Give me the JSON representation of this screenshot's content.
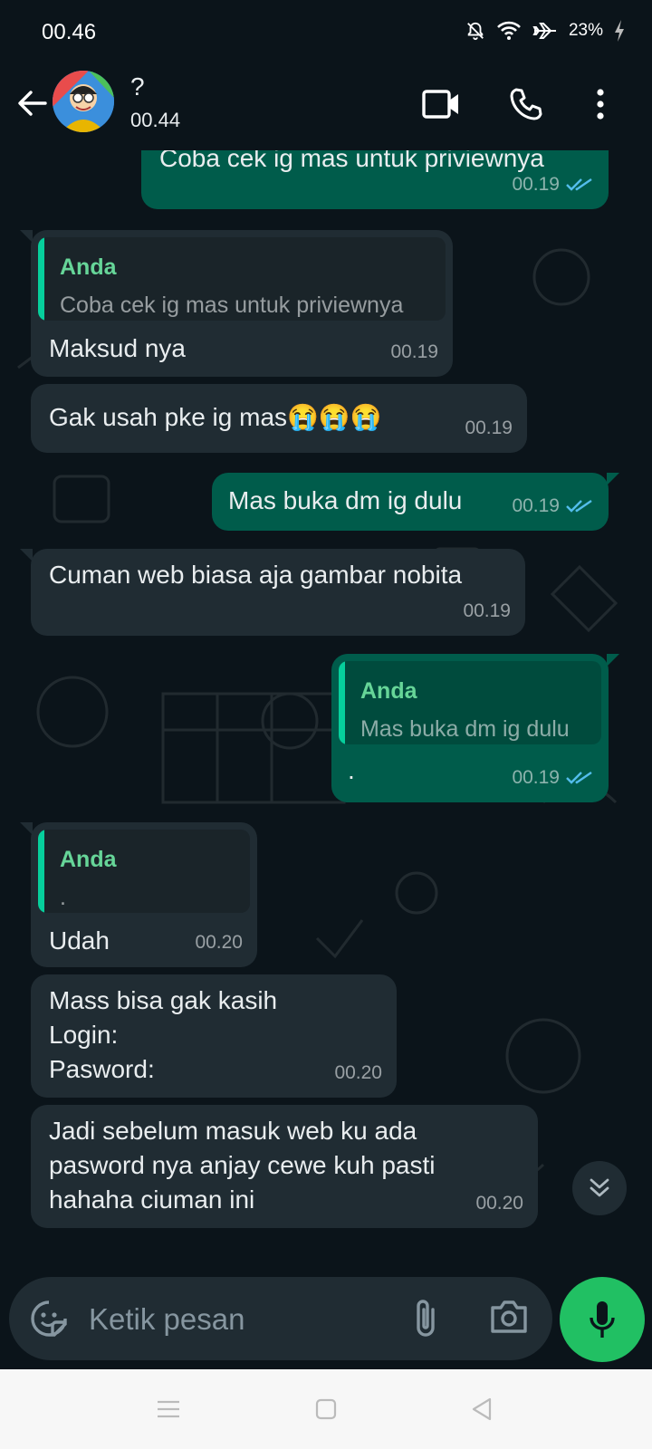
{
  "status_bar": {
    "time": "00.46",
    "battery": "23%"
  },
  "header": {
    "contact_name": "?",
    "last_seen": "00.44"
  },
  "messages": [
    {
      "direction": "out",
      "text": "Coba cek ig mas untuk priviewnya",
      "time": "00.19",
      "read": true
    },
    {
      "direction": "in",
      "quote_name": "Anda",
      "quote_text": "Coba cek ig mas untuk priviewnya",
      "text": "Maksud nya",
      "time": "00.19"
    },
    {
      "direction": "in",
      "text": "Gak usah pke ig mas😭😭😭",
      "time": "00.19"
    },
    {
      "direction": "out",
      "text": "Mas buka dm ig dulu",
      "time": "00.19",
      "read": true
    },
    {
      "direction": "in",
      "text": "Cuman web biasa aja gambar nobita",
      "time": "00.19"
    },
    {
      "direction": "out",
      "quote_name": "Anda",
      "quote_text": "Mas buka dm ig dulu",
      "text": ".",
      "time": "00.19",
      "read": true
    },
    {
      "direction": "in",
      "quote_name": "Anda",
      "quote_text": ".",
      "text": "Udah",
      "time": "00.20"
    },
    {
      "direction": "in",
      "text": "Mass bisa gak kasih\nLogin:\nPasword:",
      "time": "00.20"
    },
    {
      "direction": "in",
      "text": "Jadi sebelum masuk web ku ada\npasword nya anjay cewe kuh pasti\nhahaha ciuman ini",
      "time": "00.20"
    }
  ],
  "composer": {
    "placeholder": "Ketik pesan"
  },
  "colors": {
    "background": "#0b141a",
    "incoming_bubble": "#202c33",
    "outgoing_bubble": "#005c4b",
    "quote_name": "#66d598",
    "read_ticks": "#53bdeb",
    "mic_button": "#21c063"
  },
  "icons": {
    "status": [
      "mute-icon",
      "wifi-icon",
      "airplane-icon",
      "battery-charging-icon"
    ],
    "header": [
      "back-arrow-icon",
      "video-call-icon",
      "voice-call-icon",
      "more-options-icon"
    ],
    "composer": [
      "sticker-icon",
      "attach-icon",
      "camera-icon",
      "mic-icon"
    ],
    "navigation": [
      "nav-menu-icon",
      "nav-home-icon",
      "nav-back-icon"
    ]
  }
}
